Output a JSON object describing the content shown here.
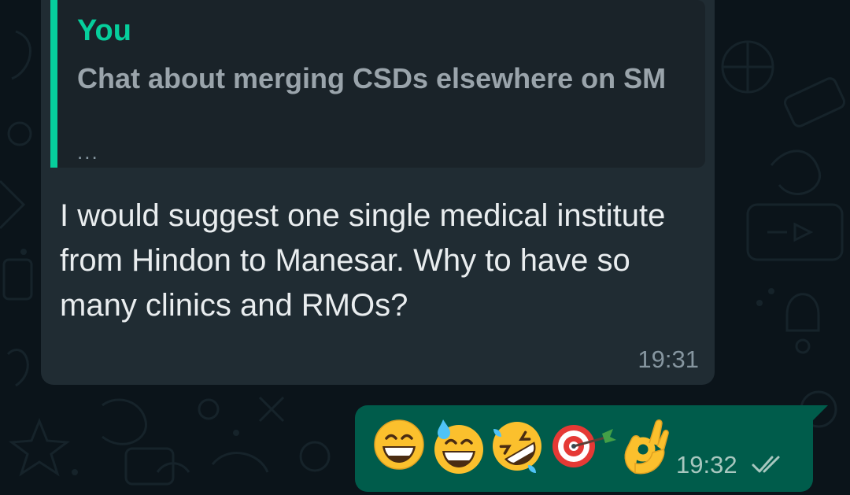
{
  "quoted_message": {
    "author": "You",
    "text": "Chat about merging CSDs elsewhere on SM",
    "ellipsis": "..."
  },
  "incoming_message": {
    "text": "I would suggest one single medical institute from Hindon to Manesar. Why to have so many clinics and RMOs?",
    "time": "19:31"
  },
  "outgoing_message": {
    "emojis": [
      "grinning-face-with-smiling-eyes",
      "grinning-face-with-sweat",
      "rolling-on-the-floor-laughing",
      "direct-hit",
      "ok-hand"
    ],
    "time": "19:32",
    "status_icon": "double-check-icon"
  },
  "colors": {
    "background": "#0b141a",
    "incoming_bubble": "#202c33",
    "outgoing_bubble": "#005c4b",
    "quote_accent": "#06cf9c"
  }
}
